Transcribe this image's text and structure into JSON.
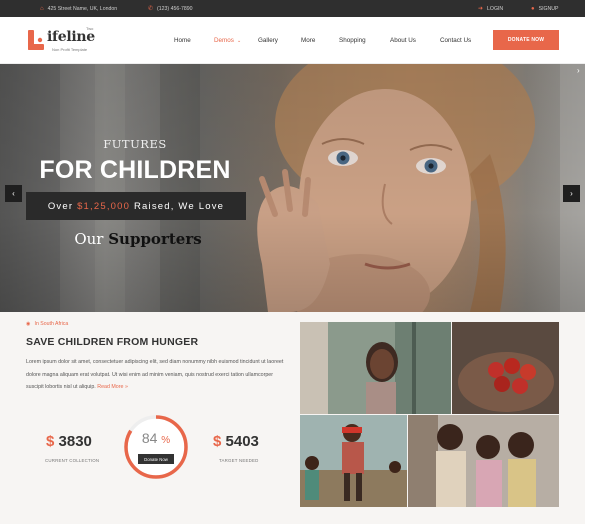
{
  "topbar": {
    "address": "425 Street Name, UK, London",
    "phone": "(123) 456-7890",
    "login": "LOGIN",
    "signup": "SIGNUP"
  },
  "logo": {
    "mark": "L",
    "text": "ifeline",
    "badge": "Two",
    "tagline": "Non Profit Template"
  },
  "nav": {
    "items": [
      "Home",
      "Demos",
      "Gallery",
      "More",
      "Shopping",
      "About Us",
      "Contact Us"
    ],
    "active": "Demos",
    "donate": "DONATE NOW"
  },
  "hero": {
    "kicker": "FUTURES",
    "headline": "FOR CHILDREN",
    "raised_prefix": "Over ",
    "raised_amount": "$1,25,000",
    "raised_suffix": " Raised, We Love",
    "supporters_prefix": "Our ",
    "supporters_bold": "Supporters",
    "prev_arrow": "‹",
    "next_arrow": "›",
    "edge_arrow": "›"
  },
  "section": {
    "location": "In South Africa",
    "title": "SAVE CHILDREN FROM HUNGER",
    "body": "Lorem ipsum dolor sit amet, consectetuer adipiscing elit, sed diam nonummy nibh euismod tincidunt ut laoreet dolore magna aliquam erat volutpat. Ut wisi enim ad minim veniam, quis nostrud exerci tation ullamcorper suscipit lobortis nisl ut aliquip.",
    "read_more": "Read More »"
  },
  "stats": {
    "currency": "$",
    "current_amount": "3830",
    "current_label": "CURRENT COLLECTION",
    "target_amount": "5403",
    "target_label": "TARGET NEEDED",
    "progress_percent": 84,
    "progress_text": "84",
    "percent_sign": "%",
    "donate_button": "Donate Now"
  },
  "colors": {
    "accent": "#e8674a",
    "dark": "#2f2f2f"
  },
  "icons": {
    "address": "home-icon",
    "phone": "phone-icon",
    "login": "login-icon",
    "signup": "user-icon",
    "location": "map-pin-icon"
  }
}
